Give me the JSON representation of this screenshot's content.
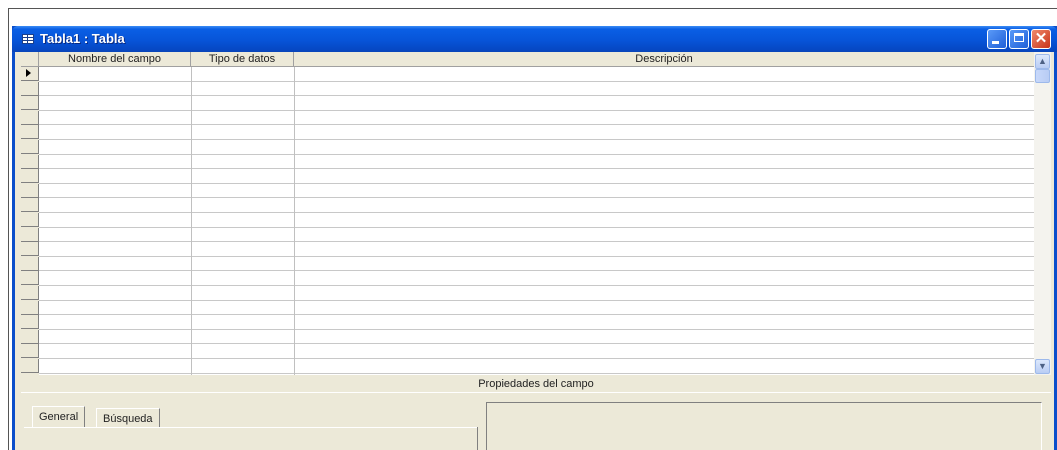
{
  "window": {
    "title": "Tabla1 : Tabla",
    "title_icon": "table-icon",
    "controls": [
      "minimize-icon",
      "maximize-icon",
      "close-icon"
    ],
    "colors": {
      "titlebar": "#0754d8",
      "close": "#c8331a",
      "face": "#ece9d8"
    }
  },
  "grid": {
    "columns": [
      "Nombre del campo",
      "Tipo de datos",
      "Descripción"
    ],
    "row_count": 21,
    "current_row": 1,
    "current_row_icon": "row-pointer-icon"
  },
  "field_properties": {
    "label": "Propiedades del campo",
    "tabs": [
      "General",
      "Búsqueda"
    ],
    "active_tab": "General"
  }
}
